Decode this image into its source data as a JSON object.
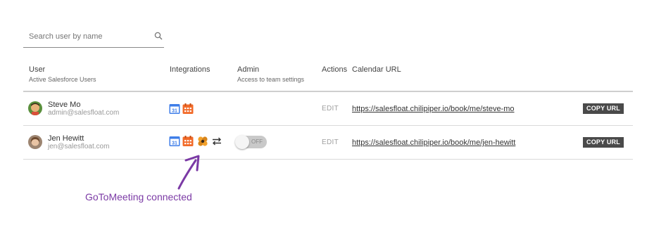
{
  "search": {
    "placeholder": "Search user by name",
    "value": ""
  },
  "table": {
    "columns": [
      {
        "label": "User",
        "sublabel": "Active Salesforce Users"
      },
      {
        "label": "Integrations",
        "sublabel": ""
      },
      {
        "label": "Admin",
        "sublabel": "Access to team settings"
      },
      {
        "label": "Actions",
        "sublabel": ""
      },
      {
        "label": "Calendar URL",
        "sublabel": ""
      }
    ],
    "rows": [
      {
        "name": "Steve Mo",
        "email": "admin@salesfloat.com",
        "integrations": [
          "google-calendar-icon",
          "office-calendar-icon"
        ],
        "integration_texts": [
          "31"
        ],
        "admin_toggle": null,
        "action": "EDIT",
        "url": "https://salesfloat.chilipiper.io/book/me/steve-mo",
        "copy_label": "COPY URL"
      },
      {
        "name": "Jen Hewitt",
        "email": "jen@salesfloat.com",
        "integrations": [
          "google-calendar-icon",
          "office-calendar-icon",
          "gotomeeting-icon",
          "sync-arrows-icon"
        ],
        "integration_texts": [
          "31"
        ],
        "admin_toggle": {
          "state": "OFF"
        },
        "action": "EDIT",
        "url": "https://salesfloat.chilipiper.io/book/me/jen-hewitt",
        "copy_label": "COPY URL"
      }
    ]
  },
  "annotation": {
    "text": "GoToMeeting connected",
    "color": "#7b3aa5"
  },
  "colors": {
    "copy_button_bg": "#4a4a4a",
    "annotation": "#7b3aa5",
    "toggle_off": "#c9c9c9"
  }
}
